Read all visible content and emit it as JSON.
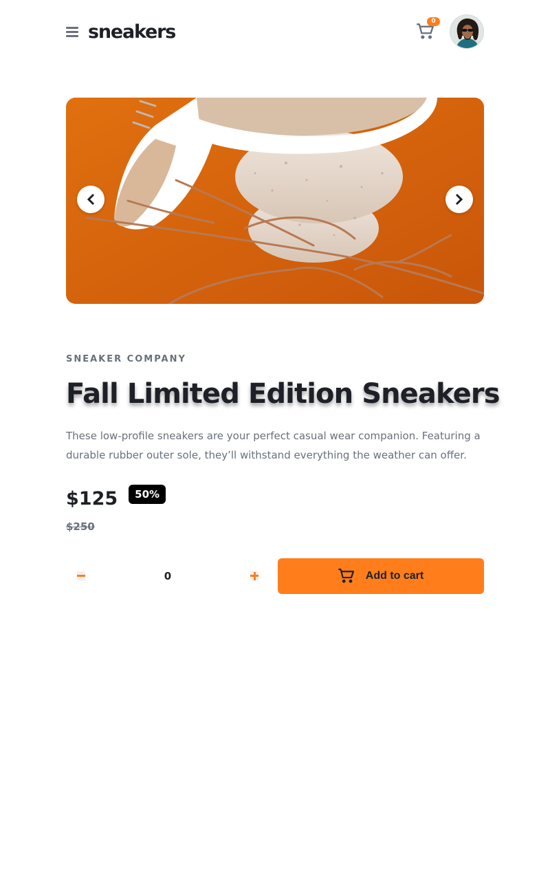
{
  "header": {
    "logo": "sneakers",
    "cart_count": "0"
  },
  "gallery": {
    "image_alt": "Sneaker resting on stacked stones over orange backdrop"
  },
  "product": {
    "company": "SNEAKER COMPANY",
    "title": "Fall Limited Edition Sneakers",
    "description": "These low-profile sneakers are your perfect casual wear companion. Featuring a durable rubber outer sole, they’ll withstand everything the weather can offer.",
    "price": "$125",
    "discount": "50%",
    "old_price": "$250"
  },
  "quantity": {
    "value": "0"
  },
  "actions": {
    "add_to_cart": "Add to cart"
  },
  "colors": {
    "accent": "#ff7e1b",
    "text_dark": "#1d2026",
    "text_muted": "#68707d",
    "badge_bg": "#000000"
  }
}
